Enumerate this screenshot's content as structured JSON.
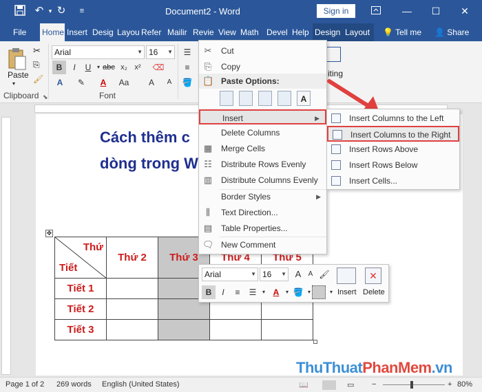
{
  "window": {
    "title": "Document2 - Word",
    "sign_in": "Sign in"
  },
  "tabs": [
    "File",
    "Home",
    "Insert",
    "Desig",
    "Layou",
    "Refer",
    "Mailir",
    "Revie",
    "View",
    "Math",
    "Devel",
    "Help",
    "Design",
    "Layout"
  ],
  "tell_me": "Tell me",
  "share": "Share",
  "ribbon": {
    "paste_label": "Paste",
    "clipboard_group": "Clipboard",
    "font_group": "Font",
    "font_name": "Arial",
    "font_size": "16",
    "editing_label": "iting"
  },
  "document": {
    "heading_line1": "Cách thêm c",
    "heading_line2": "dòng trong W",
    "table": {
      "corner_top": "Thứ",
      "corner_bottom": "Tiết",
      "headers": [
        "Thứ 2",
        "Thứ 3",
        "Thứ 4",
        "Thứ 5"
      ],
      "rows": [
        "Tiết 1",
        "Tiết 2",
        "Tiết 3"
      ]
    }
  },
  "context_menu": {
    "cut": "Cut",
    "copy": "Copy",
    "paste_options": "Paste Options:",
    "insert": "Insert",
    "delete_columns": "Delete Columns",
    "merge_cells": "Merge Cells",
    "distribute_rows": "Distribute Rows Evenly",
    "distribute_columns": "Distribute Columns Evenly",
    "border_styles": "Border Styles",
    "text_direction": "Text Direction...",
    "table_properties": "Table Properties...",
    "new_comment": "New Comment"
  },
  "insert_submenu": {
    "left": "Insert Columns to the Left",
    "right": "Insert Columns to the Right",
    "above": "Insert Rows Above",
    "below": "Insert Rows Below",
    "cells": "Insert Cells..."
  },
  "mini_toolbar": {
    "font_name": "Arial",
    "font_size": "16",
    "insert_label": "Insert",
    "delete_label": "Delete"
  },
  "status": {
    "page": "Page 1 of 2",
    "words": "269 words",
    "language": "English (United States)",
    "zoom": "80%"
  },
  "watermark": {
    "part1": "ThuThuat",
    "part2": "PhanMem",
    "part3": ".vn"
  },
  "colors": {
    "word_blue": "#2b579a",
    "heading": "#1f2f8f",
    "table_text": "#cc1b1b",
    "highlight_border": "#e04040"
  }
}
